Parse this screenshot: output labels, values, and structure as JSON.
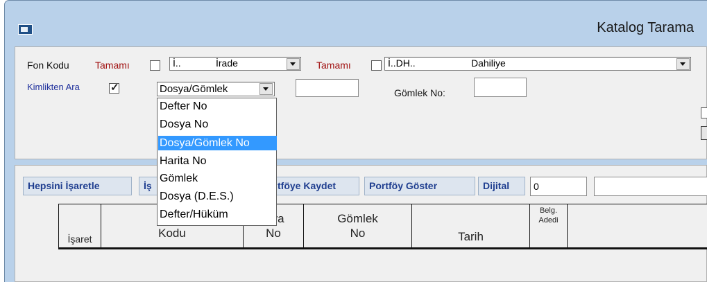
{
  "window": {
    "title": "Katalog Tarama"
  },
  "filters": {
    "fon_kodu_label": "Fon Kodu",
    "tamami1_label": "Tamamı",
    "combo1_code": "İ..",
    "combo1_name": "İrade",
    "tamami2_label": "Tamamı",
    "combo2_code": "İ..DH..",
    "combo2_name": "Dahiliye",
    "kimlikten_ara_label": "Kimlikten Ara",
    "kimlikten_ara_checked": true,
    "search_type_value": "Dosya/Gömlek",
    "gomlek_no_label": "Gömlek No:"
  },
  "dropdown": {
    "items": [
      "Defter No",
      "Dosya No",
      "Dosya/Gömlek No",
      "Harita No",
      "Gömlek",
      "Dosya (D.E.S.)",
      "Defter/Hüküm"
    ],
    "selected": "Dosya/Gömlek No"
  },
  "toolbar": {
    "select_all": "Hepsini İşaretle",
    "partial_left": "İş",
    "portfolio_save": "tföye Kaydet",
    "portfolio_show": "Portföy Göster",
    "digital": "Dijital",
    "count_value": "0"
  },
  "table": {
    "headers": {
      "isaret": "İşaret",
      "kodu": "Kodu",
      "dosya_top": "ısya",
      "dosya_bottom": "No",
      "gomlek_top": "Gömlek",
      "gomlek_bottom": "No",
      "tarih": "Tarih",
      "belge_top": "Belg.",
      "belge_bottom": "Adedi"
    }
  }
}
